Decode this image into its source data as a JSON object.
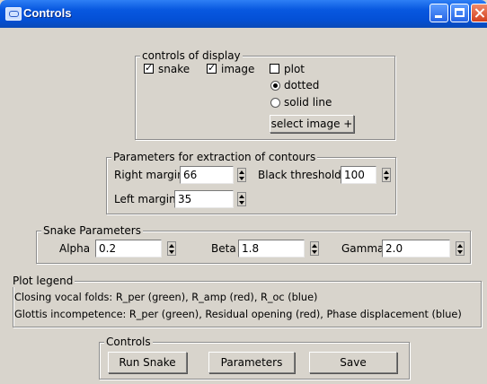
{
  "window": {
    "title": "Controls"
  },
  "display": {
    "legend": "controls of display",
    "snake_label": "snake",
    "image_label": "image",
    "plot_label": "plot",
    "dotted_label": "dotted",
    "solid_label": "solid line",
    "select_image_label": "select image +"
  },
  "contours": {
    "legend": "Parameters for extraction of contours",
    "right_margin_label": "Right margin",
    "right_margin_value": "66",
    "black_threshold_label": "Black threshold",
    "black_threshold_value": "100",
    "left_margin_label": "Left margin",
    "left_margin_value": "35"
  },
  "snake": {
    "legend": "Snake Parameters",
    "alpha_label": "Alpha",
    "alpha_value": "0.2",
    "beta_label": "Beta",
    "beta_value": "1.8",
    "gamma_label": "Gamma",
    "gamma_value": "2.0"
  },
  "plot_legend": {
    "legend": "Plot legend",
    "line1": "Closing vocal folds: R_per (green), R_amp (red), R_oc (blue)",
    "line2": "Glottis incompetence: R_per (green), Residual opening (red), Phase displacement (blue)"
  },
  "controls": {
    "legend": "Controls",
    "run_label": "Run Snake",
    "parameters_label": "Parameters",
    "save_label": "Save"
  }
}
